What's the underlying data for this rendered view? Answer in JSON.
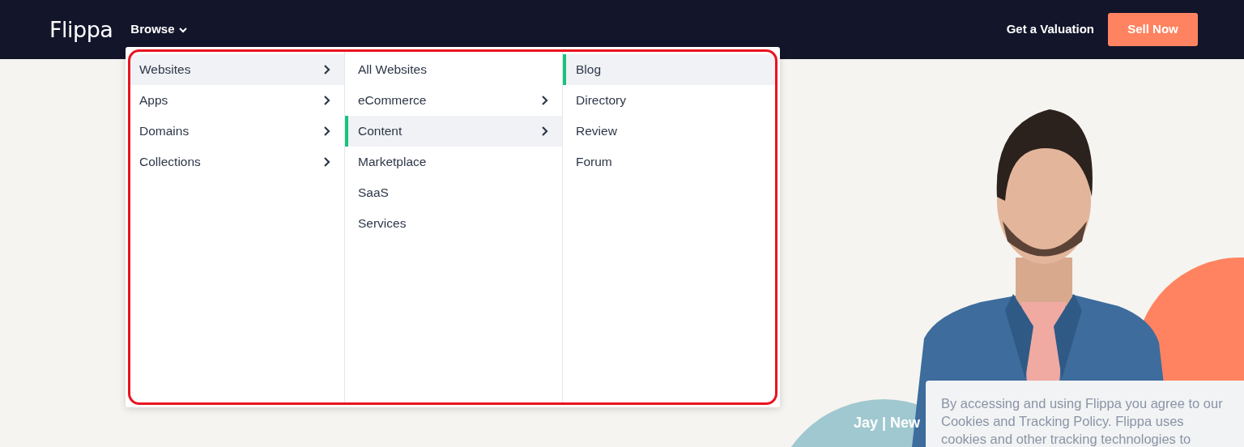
{
  "header": {
    "logo": "Flippa",
    "nav": [
      {
        "label": "Browse",
        "expanded": true
      }
    ],
    "link": "Get a Valuation",
    "button": "Sell Now"
  },
  "menu": {
    "highlighted": true,
    "columns": [
      {
        "items": [
          {
            "label": "Websites",
            "has_submenu": true,
            "selected": true
          },
          {
            "label": "Apps",
            "has_submenu": true,
            "selected": false
          },
          {
            "label": "Domains",
            "has_submenu": true,
            "selected": false
          },
          {
            "label": "Collections",
            "has_submenu": true,
            "selected": false
          }
        ]
      },
      {
        "items": [
          {
            "label": "All Websites",
            "has_submenu": false,
            "selected": false
          },
          {
            "label": "eCommerce",
            "has_submenu": true,
            "selected": false
          },
          {
            "label": "Content",
            "has_submenu": true,
            "selected": true
          },
          {
            "label": "Marketplace",
            "has_submenu": false,
            "selected": false
          },
          {
            "label": "SaaS",
            "has_submenu": false,
            "selected": false
          },
          {
            "label": "Services",
            "has_submenu": false,
            "selected": false
          }
        ]
      },
      {
        "items": [
          {
            "label": "Blog",
            "has_submenu": false,
            "selected": true
          },
          {
            "label": "Directory",
            "has_submenu": false,
            "selected": false
          },
          {
            "label": "Review",
            "has_submenu": false,
            "selected": false
          },
          {
            "label": "Forum",
            "has_submenu": false,
            "selected": false
          }
        ]
      }
    ]
  },
  "hero": {
    "caption": "Jay | New"
  },
  "cookie_banner": {
    "text": "By accessing and using Flippa you agree to our Cookies and Tracking Policy. Flippa uses cookies and other tracking technologies to"
  }
}
